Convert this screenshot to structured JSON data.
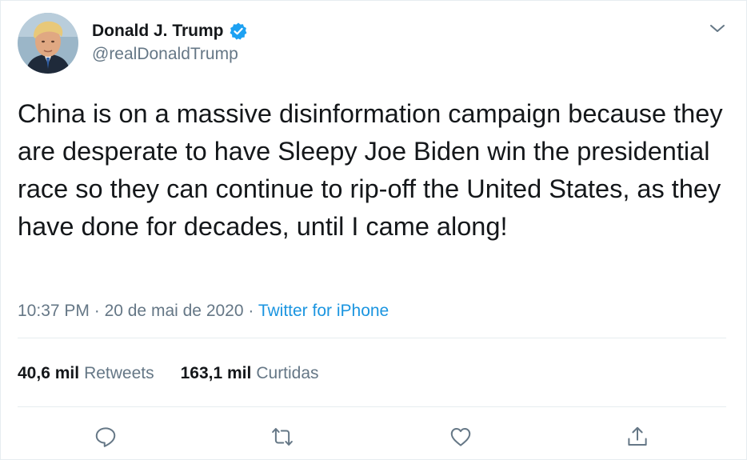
{
  "user": {
    "display_name": "Donald J. Trump",
    "handle": "@realDonaldTrump",
    "verified": true
  },
  "tweet": {
    "text": "China is on a massive disinformation campaign because they are desperate to have Sleepy Joe Biden win the presidential race so they can continue to rip-off the United States, as they have done for decades, until I came along!",
    "time": "10:37 PM",
    "separator": " · ",
    "date": "20 de mai de 2020",
    "source": "Twitter for iPhone"
  },
  "stats": {
    "retweets_count": "40,6 mil",
    "retweets_label": "Retweets",
    "likes_count": "163,1 mil",
    "likes_label": "Curtidas"
  },
  "icons": {
    "verified": "verified-badge-icon",
    "menu": "chevron-down-icon",
    "reply": "reply-icon",
    "retweet": "retweet-icon",
    "like": "heart-icon",
    "share": "share-icon"
  },
  "colors": {
    "text": "#14171a",
    "muted": "#657786",
    "link": "#1b95e0",
    "verified": "#1da1f2",
    "divider": "#e6ecf0"
  }
}
